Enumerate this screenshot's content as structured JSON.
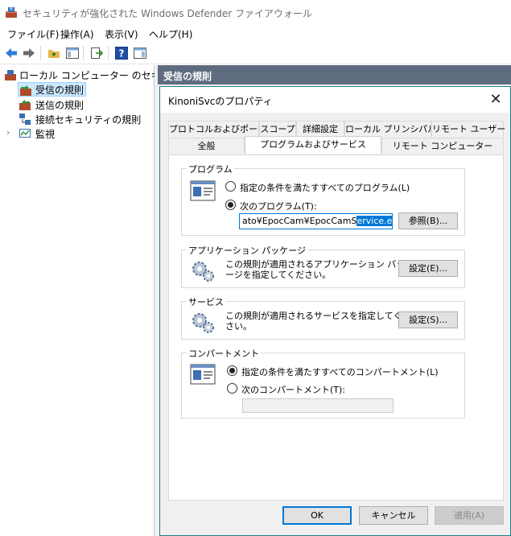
{
  "window": {
    "title": "セキュリティが強化された Windows Defender ファイアウォール"
  },
  "menu": [
    {
      "label": "ファイル(F)"
    },
    {
      "label": "操作(A)"
    },
    {
      "label": "表示(V)"
    },
    {
      "label": "ヘルプ(H)"
    }
  ],
  "tree": {
    "root": "ローカル コンピューター のセキュリティ:",
    "items": [
      {
        "label": "受信の規則"
      },
      {
        "label": "送信の規則"
      },
      {
        "label": "接続セキュリティの規則"
      },
      {
        "label": "監視"
      }
    ]
  },
  "right_header": "受信の規則",
  "dialog": {
    "title": "KinoniSvcのプロパティ",
    "close_glyph": "✕",
    "tabs_row1": [
      {
        "label": "プロトコルおよびポート"
      },
      {
        "label": "スコープ"
      },
      {
        "label": "詳細設定"
      },
      {
        "label": "ローカル プリンシパル"
      },
      {
        "label": "リモート ユーザー"
      }
    ],
    "tabs_row2": [
      {
        "label": "全般"
      },
      {
        "label": "プログラムおよびサービス"
      },
      {
        "label": "リモート コンピューター"
      }
    ],
    "program_group": {
      "title": "プログラム",
      "option_all": "指定の条件を満たすすべてのプログラム(L)",
      "option_this": "次のプログラム(T):",
      "path_plain": "ato¥EpocCam¥EpocCamS",
      "path_selected": "ervice.exe",
      "browse_button": "参照(B)..."
    },
    "package_group": {
      "title": "アプリケーション パッケージ",
      "desc_line1": "この規則が適用されるアプリケーション パッケ",
      "desc_line2": "ージを指定してください。",
      "settings_button": "設定(E)..."
    },
    "service_group": {
      "title": "サービス",
      "desc_line1": "この規則が適用されるサービスを指定してくだ",
      "desc_line2": "さい。",
      "settings_button": "設定(S)..."
    },
    "compartment_group": {
      "title": "コンパートメント",
      "option_all": "指定の条件を満たすすべてのコンパートメント(L)",
      "option_this": "次のコンパートメント(T):"
    },
    "buttons": {
      "ok": "OK",
      "cancel": "キャンセル",
      "apply": "適用(A)"
    }
  },
  "colors": {
    "accent": "#0078d7",
    "header_bg": "#5f6c80",
    "dialog_border": "#1e7f86"
  }
}
